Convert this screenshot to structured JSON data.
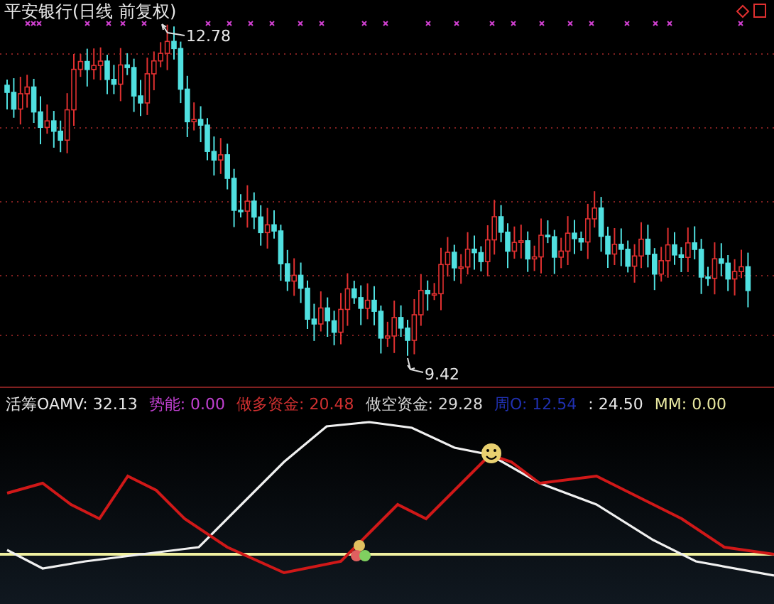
{
  "price_panel": {
    "title": "平安银行(日线 前复权)",
    "high_label": "12.78",
    "low_label": "9.42"
  },
  "indicator_legend": [
    {
      "label": "活筹OAMV:",
      "value": "32.13",
      "color": "#e8e8e8"
    },
    {
      "label": "势能:",
      "value": "0.00",
      "color": "#c040d0"
    },
    {
      "label": "做多资金:",
      "value": "20.48",
      "color": "#d03030"
    },
    {
      "label": "做空资金:",
      "value": "29.28",
      "color": "#d8d8d8"
    },
    {
      "label": "周O:",
      "value": "12.54",
      "color": "#2030b0"
    },
    {
      "label": ":",
      "value": "24.50",
      "color": "#e8e8e8"
    },
    {
      "label": "MM:",
      "value": "0.00",
      "color": "#e8e8a0"
    }
  ]
}
